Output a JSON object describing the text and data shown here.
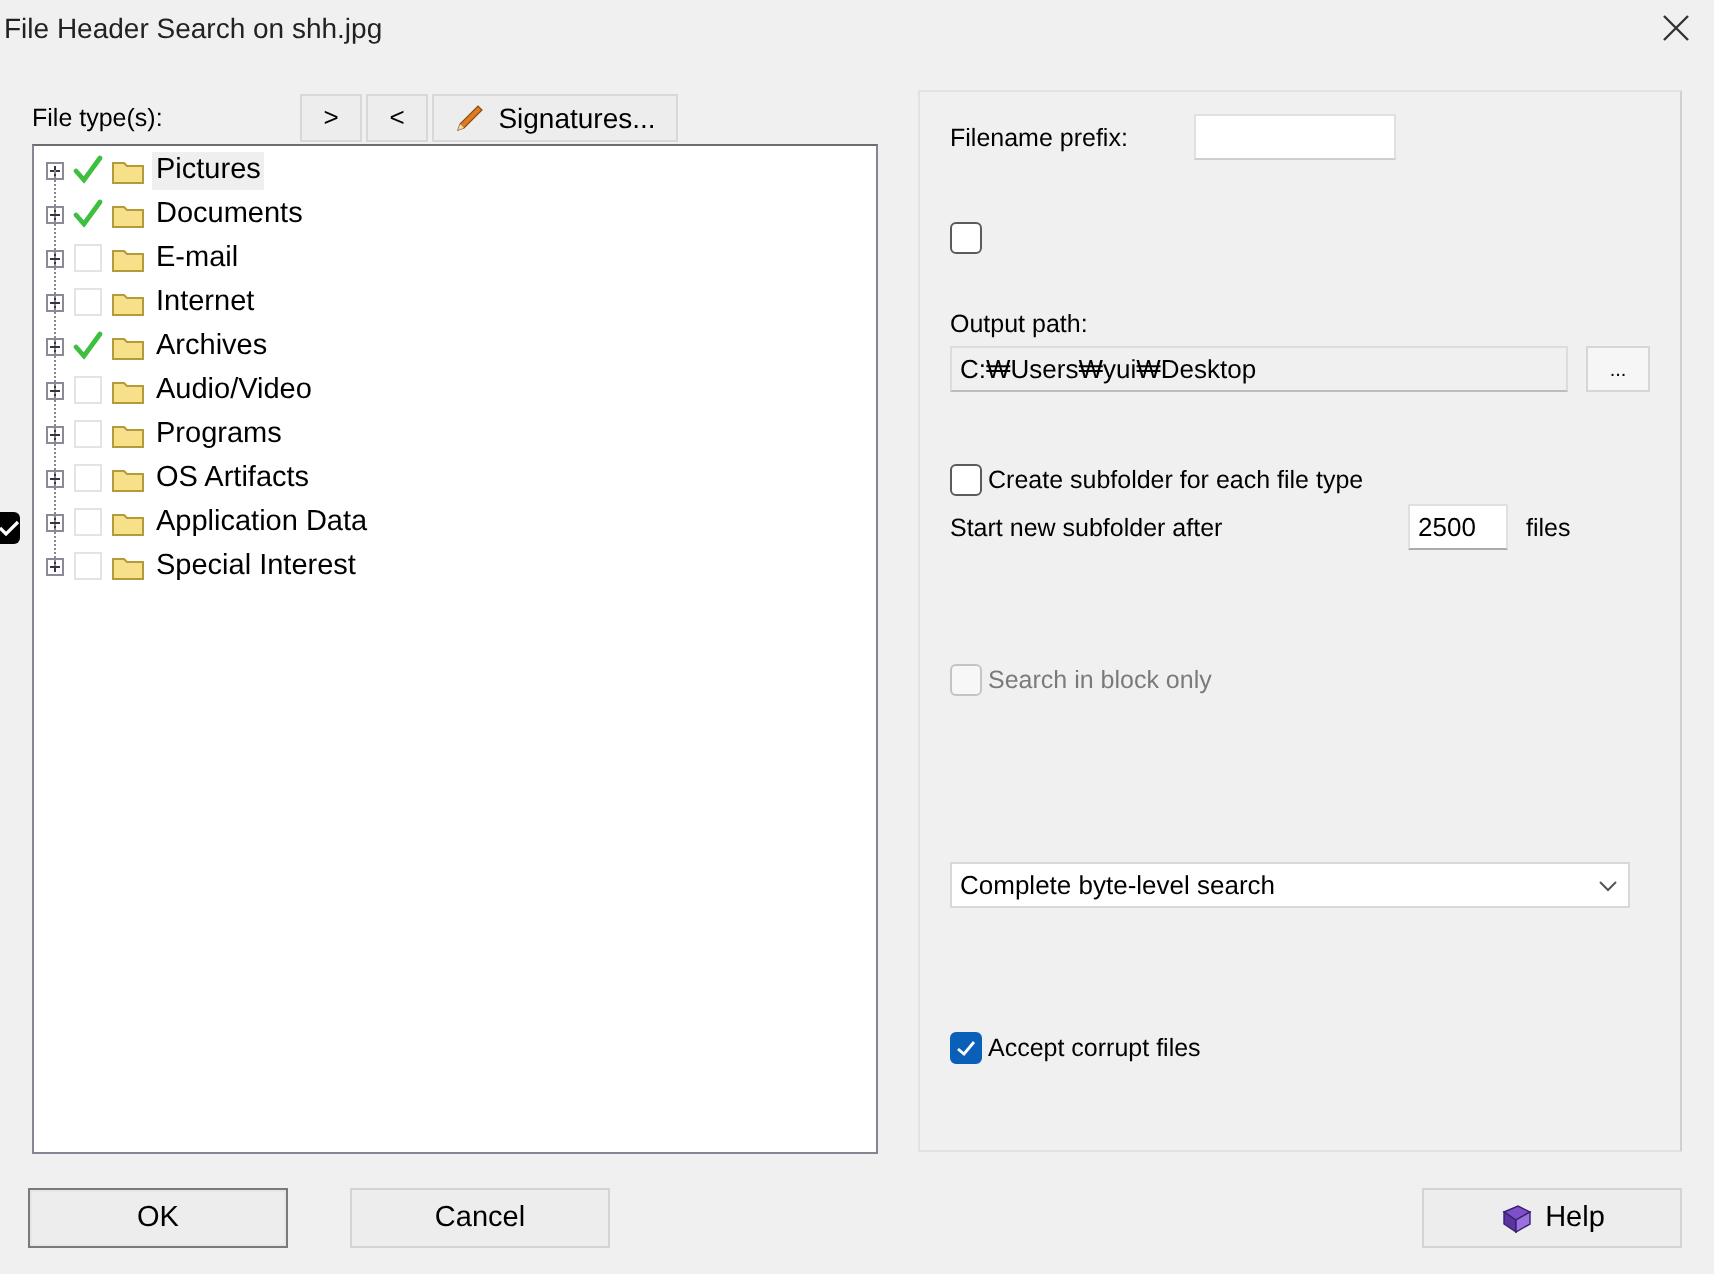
{
  "window": {
    "title": "File Header Search on shh.jpg"
  },
  "edge_checkbox": {
    "checked": true
  },
  "file_types": {
    "label": "File type(s):",
    "move_buttons": [
      ">",
      "<"
    ],
    "signatures_button": "Signatures...",
    "items": [
      {
        "label": "Pictures",
        "checked": true,
        "selected": true
      },
      {
        "label": "Documents",
        "checked": true,
        "selected": false
      },
      {
        "label": "E-mail",
        "checked": false,
        "selected": false
      },
      {
        "label": "Internet",
        "checked": false,
        "selected": false
      },
      {
        "label": "Archives",
        "checked": true,
        "selected": false
      },
      {
        "label": "Audio/Video",
        "checked": false,
        "selected": false
      },
      {
        "label": "Programs",
        "checked": false,
        "selected": false
      },
      {
        "label": "OS Artifacts",
        "checked": false,
        "selected": false
      },
      {
        "label": "Application Data",
        "checked": false,
        "selected": false
      },
      {
        "label": "Special Interest",
        "checked": false,
        "selected": false
      }
    ]
  },
  "options": {
    "filename_prefix": {
      "label": "Filename prefix:"
    },
    "unlabeled_checkbox": {
      "checked": false
    },
    "output_path": {
      "label": "Output path:",
      "value": "C:₩Users₩yui₩Desktop",
      "browse_button": "..."
    },
    "create_subfolder": {
      "label": "Create subfolder for each file type",
      "checked": false
    },
    "subfolder_after": {
      "label": "Start new subfolder after",
      "value": "2500",
      "unit": "files"
    },
    "search_in_block": {
      "label": "Search in block only",
      "checked": false,
      "disabled": true
    },
    "search_mode": {
      "value": "Complete byte-level search"
    },
    "accept_corrupt": {
      "label": "Accept corrupt files",
      "checked": true
    }
  },
  "buttons": [
    {
      "label": "OK",
      "kind": "default"
    },
    {
      "label": "Cancel",
      "kind": "plain"
    },
    {
      "label": "Help",
      "kind": "help"
    }
  ]
}
